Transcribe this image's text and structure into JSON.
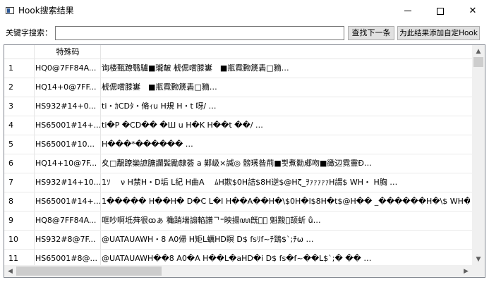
{
  "window": {
    "title": "Hook搜索结果",
    "icon": "app-window-icon",
    "controls": {
      "minimize": "minimize-icon",
      "maximize": "maximize-icon",
      "close": "✕"
    }
  },
  "search": {
    "label": "关键字搜索：",
    "value": "",
    "next_button": "查找下一条",
    "add_button": "为此结果添加自定Hook"
  },
  "table": {
    "columns": [
      "",
      "特殊码",
      ""
    ],
    "rows": [
      {
        "index": "1",
        "code": "HQ0@7FF84A...",
        "content": "询楼甄蹽翳驢■瓏皶 椃偲嚐膝㟺　■瓶霓覅篪砉□豴…"
      },
      {
        "index": "2",
        "code": "HQ14+0@7FF...",
        "content": "椃偲嚐膝㟺　■瓶霓覅篪砉□豴…"
      },
      {
        "index": "3",
        "code": "HS932#14+0...",
        "content": "ti・ｶCDﾀ・脩ｨu H規 H・t 呀/ …"
      },
      {
        "index": "4",
        "code": "HS65001#14+...",
        "content": "ti�P �CD�� �Ш u H�K H��t ��/ …"
      },
      {
        "index": "5",
        "code": "HS65001#10...",
        "content": "H���*������ …"
      },
      {
        "index": "6",
        "code": "HQ14+10@7F...",
        "content": "夊□覯蹽欒謶膅讕鬓勵隸荟 a 鄚岋×諴◎ 髈璓昝荊■뾧煮勬郕吻■豃辺霓霻Ð…"
      },
      {
        "index": "7",
        "code": "HS932#14+10...",
        "content": "1ｿ　 ν H禁H・D垢 L紀 H曲A　 ﾑH欺$0H詰$8H逆$@Hζ_ｦｧｧｧｧｧH謂$ WH・ H胸 …"
      },
      {
        "index": "8",
        "code": "HS65001#14+...",
        "content": "1����� H��H� D�C L�I H��A��H�\\$0H�l$8H�t$@H�� _������H�\\$ WH�� H�� …"
      },
      {
        "index": "9",
        "code": "HQ8@7FF84A...",
        "content": "哐吵啊坻荈很ꝏぁ 穐踃㙐謆輡譜ᄀ⁼映揚ꦪ旣𮡄𠛂 魁黢𡇒颉蚚 ů…"
      },
      {
        "index": "10",
        "code": "HS932#8@7F...",
        "content": "@UATAUAWH・8 A0帰 H矩L蠣HD瞑 D$ fsﾘf~ﾁ鵄$`;ﾁω …"
      },
      {
        "index": "11",
        "code": "HS65001#8@...",
        "content": "@UATAUAWH��8 A0�A H��L�aHD�i D$ fs�f~��L$`;� �� …"
      }
    ]
  },
  "scrollbars": {
    "up": "▲",
    "down": "▼",
    "left": "◀",
    "right": "▶"
  }
}
